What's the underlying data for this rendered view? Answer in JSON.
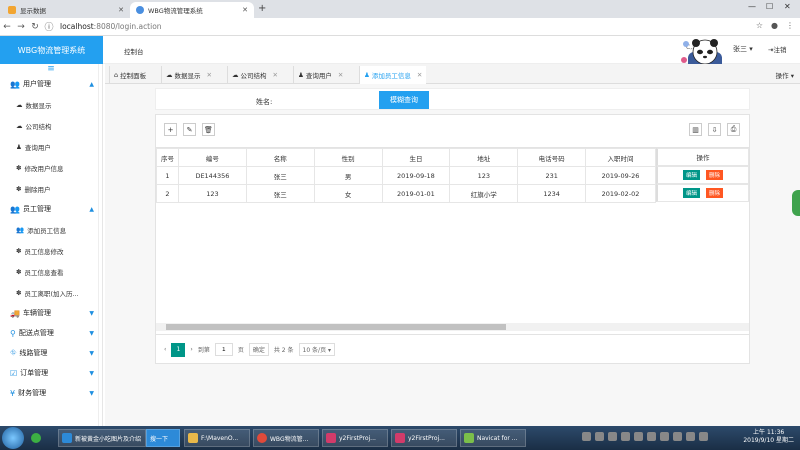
{
  "browser": {
    "tabs": [
      {
        "label": "显示数据",
        "color": "#f2a531"
      },
      {
        "label": "WBG物流管理系统",
        "color": "#4a8fe0"
      }
    ],
    "url_host": "localhost",
    "url_rest": ":8080/login.action"
  },
  "header": {
    "brand": "WBG物流管理系统",
    "dashboard_label": "控制台",
    "user_prefix": "C,:S",
    "user_name": "张三 ▾",
    "logout_label": "注销"
  },
  "sidebar": {
    "groups": [
      {
        "label": "用户管理",
        "items": [
          "数据显示",
          "公司结构",
          "查询用户",
          "修改用户信息",
          "删除用户"
        ]
      },
      {
        "label": "员工管理",
        "items": [
          "添加员工信息",
          "员工信息修改",
          "员工信息查看",
          "员工离职(加入历..."
        ]
      },
      {
        "label": "车辆管理",
        "items": []
      },
      {
        "label": "配送点管理",
        "items": []
      },
      {
        "label": "线路管理",
        "items": []
      },
      {
        "label": "订单管理",
        "items": []
      },
      {
        "label": "财务管理",
        "items": []
      }
    ]
  },
  "tabs": [
    {
      "label": "控制面板"
    },
    {
      "label": "数据显示"
    },
    {
      "label": "公司结构"
    },
    {
      "label": "查询用户"
    },
    {
      "label": "添加员工信息"
    }
  ],
  "tab_ops": "操作 ▾",
  "search": {
    "label": "姓名:",
    "placeholder": "",
    "button": "模糊查询"
  },
  "table": {
    "columns": [
      "序号",
      "编号",
      "名称",
      "性别",
      "生日",
      "地址",
      "电话号码",
      "入职时间"
    ],
    "ops_header": "操作",
    "rows": [
      [
        "1",
        "DE144356",
        "张三",
        "男",
        "2019-09-18",
        "123",
        "231",
        "2019-09-26"
      ],
      [
        "2",
        "123",
        "张三",
        "女",
        "2019-01-01",
        "红旗小学",
        "1234",
        "2019-02-02"
      ]
    ],
    "edit_label": "编辑",
    "delete_label": "删除"
  },
  "pager": {
    "current": "1",
    "goto_label": "到第",
    "page_input": "1",
    "page_unit": "页",
    "confirm": "确定",
    "total": "共 2 条",
    "page_size": "10 条/页 ▾"
  },
  "taskbar": {
    "items": [
      {
        "label": "新被黄金小吃图片及介绍",
        "color": "#2d8ad8"
      },
      {
        "label": "搜一下",
        "color": "#2d8ad8"
      },
      {
        "label": "F:\\MavenO...",
        "color": "#e8b84a"
      },
      {
        "label": "WBG物流管...",
        "color": "#e04a3a"
      },
      {
        "label": "y2FirstProj...",
        "color": "#d23b6a"
      },
      {
        "label": "y2FirstProj...",
        "color": "#d23b6a"
      },
      {
        "label": "Navicat for ...",
        "color": "#7bbf4a"
      }
    ],
    "time": "上午 11:36",
    "date": "2019/9/10 星期二"
  }
}
